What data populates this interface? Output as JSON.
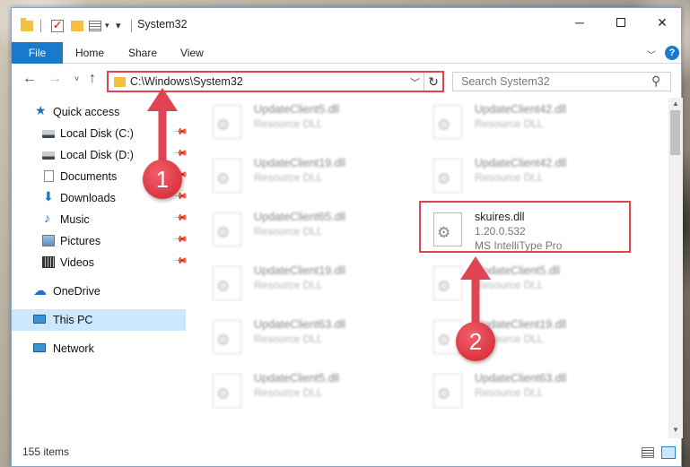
{
  "window": {
    "title": "System32",
    "controls": {
      "minimize": "─",
      "close": "✕"
    }
  },
  "ribbon": {
    "tabs": [
      "File",
      "Home",
      "Share",
      "View"
    ],
    "help": "?"
  },
  "nav": {
    "address": "C:\\Windows\\System32",
    "search_placeholder": "Search System32"
  },
  "sidebar": {
    "items": [
      {
        "label": "Quick access",
        "icon": "star-icon",
        "pinned": false
      },
      {
        "label": "Local Disk (C:)",
        "icon": "drive-icon",
        "pinned": true
      },
      {
        "label": "Local Disk (D:)",
        "icon": "drive-icon",
        "pinned": true
      },
      {
        "label": "Documents",
        "icon": "documents-icon",
        "pinned": true
      },
      {
        "label": "Downloads",
        "icon": "download-icon",
        "pinned": true
      },
      {
        "label": "Music",
        "icon": "music-icon",
        "pinned": true
      },
      {
        "label": "Pictures",
        "icon": "pictures-icon",
        "pinned": true
      },
      {
        "label": "Videos",
        "icon": "videos-icon",
        "pinned": true
      },
      {
        "label": "OneDrive",
        "icon": "cloud-icon",
        "pinned": false
      },
      {
        "label": "This PC",
        "icon": "computer-icon",
        "pinned": false,
        "selected": true
      },
      {
        "label": "Network",
        "icon": "network-icon",
        "pinned": false
      }
    ]
  },
  "files": {
    "left": [
      {
        "name": "UpdateClient5.dll",
        "type": "Resource DLL"
      },
      {
        "name": "UpdateClient19.dll",
        "type": "Resource DLL"
      },
      {
        "name": "UpdateClient65.dll",
        "type": "Resource DLL"
      },
      {
        "name": "UpdateClient19.dll",
        "type": "Resource DLL"
      },
      {
        "name": "UpdateClient63.dll",
        "type": "Resource DLL"
      },
      {
        "name": "UpdateClient5.dll",
        "type": "Resource DLL"
      }
    ],
    "right": [
      {
        "name": "UpdateClient42.dll",
        "type": "Resource DLL"
      },
      {
        "name": "UpdateClient42.dll",
        "type": "Resource DLL"
      },
      {
        "name": "UpdateClient5.dll",
        "type": "Resource DLL"
      },
      {
        "name": "UpdateClient19.dll",
        "type": "Resource DLL"
      },
      {
        "name": "UpdateClient63.dll",
        "type": "Resource DLL"
      }
    ],
    "highlighted": {
      "name": "skuires.dll",
      "version": "1.20.0.532",
      "description": "MS IntelliType Pro"
    }
  },
  "status": {
    "item_count": "155 items"
  },
  "annotations": {
    "step1": "1",
    "step2": "2",
    "color": "#e04351"
  }
}
